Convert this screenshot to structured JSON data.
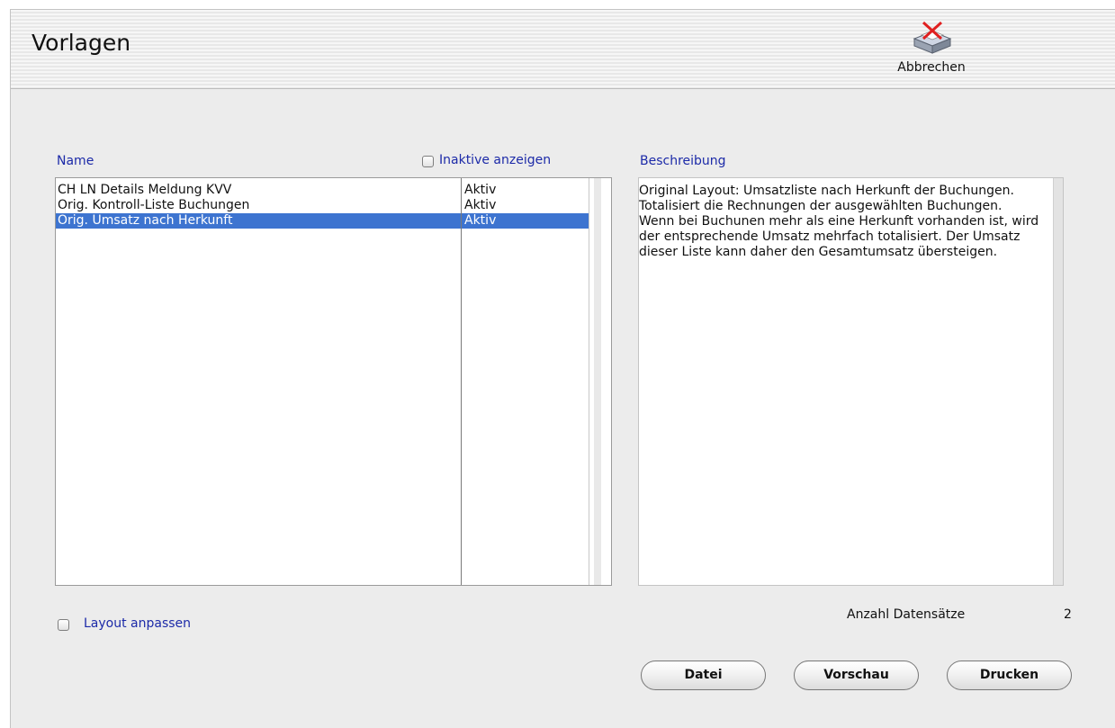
{
  "header": {
    "title": "Vorlagen",
    "cancel_label": "Abbrechen"
  },
  "list": {
    "name_label": "Name",
    "show_inactive_label": "Inaktive anzeigen",
    "rows": [
      {
        "name": "CH LN Details Meldung KVV",
        "status": "Aktiv"
      },
      {
        "name": "Orig. Kontroll-Liste Buchungen",
        "status": "Aktiv"
      },
      {
        "name": "Orig. Umsatz nach Herkunft",
        "status": "Aktiv"
      }
    ]
  },
  "description": {
    "label": "Beschreibung",
    "text": "Original Layout: Umsatzliste nach Herkunft der Buchungen. Totalisiert die Rechnungen der ausgewählten Buchungen. Wenn bei Buchunen mehr als eine Herkunft vorhanden ist, wird der entsprechende Umsatz mehrfach totalisiert. Der Umsatz dieser Liste kann daher den Gesamtumsatz übersteigen."
  },
  "layout_adjust_label": "Layout anpassen",
  "record_count": {
    "label": "Anzahl Datensätze",
    "value": "2"
  },
  "buttons": {
    "file": "Datei",
    "preview": "Vorschau",
    "print": "Drucken"
  }
}
